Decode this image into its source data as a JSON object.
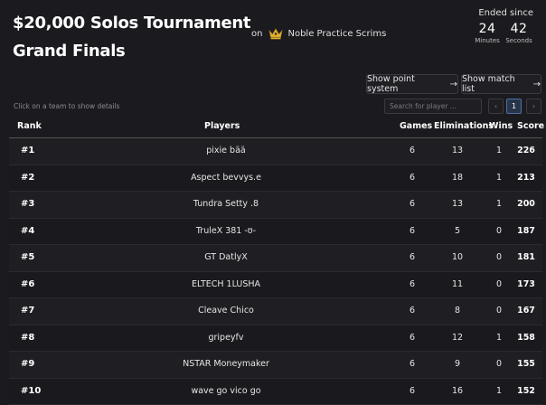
{
  "tournament": {
    "title_line1": "$20,000 Solos Tournament",
    "title_line2": "Grand Finals",
    "on_label": "on",
    "organizer": "Noble Practice Scrims",
    "organizer_icon": "crown-icon",
    "accent_color": "#e0b030"
  },
  "countdown": {
    "label": "Ended since",
    "minutes": "24",
    "minutes_label": "Minutes",
    "seconds": "42",
    "seconds_label": "Seconds"
  },
  "actions": {
    "point_system": "Show point system",
    "match_list": "Show match list",
    "arrow": "→"
  },
  "controls": {
    "hint": "Click on a team to show details",
    "search_placeholder": "Search for player ...",
    "prev": "‹",
    "current_page": "1",
    "next": "›"
  },
  "table": {
    "headers": {
      "rank": "Rank",
      "players": "Players",
      "games": "Games",
      "eliminations": "Eliminations",
      "wins": "Wins",
      "score": "Score"
    },
    "rows": [
      {
        "rank": "#1",
        "player": "pixie bää",
        "games": "6",
        "eliminations": "13",
        "wins": "1",
        "score": "226"
      },
      {
        "rank": "#2",
        "player": "Aspect bevvys.e",
        "games": "6",
        "eliminations": "18",
        "wins": "1",
        "score": "213"
      },
      {
        "rank": "#3",
        "player": "Tundra Setty .8",
        "games": "6",
        "eliminations": "13",
        "wins": "1",
        "score": "200"
      },
      {
        "rank": "#4",
        "player": "TruleX 381 -ʊ-",
        "games": "6",
        "eliminations": "5",
        "wins": "0",
        "score": "187"
      },
      {
        "rank": "#5",
        "player": "GT DatlyX",
        "games": "6",
        "eliminations": "10",
        "wins": "0",
        "score": "181"
      },
      {
        "rank": "#6",
        "player": "ELTECH 1LUSHA",
        "games": "6",
        "eliminations": "11",
        "wins": "0",
        "score": "173"
      },
      {
        "rank": "#7",
        "player": "Cleave Chico",
        "games": "6",
        "eliminations": "8",
        "wins": "0",
        "score": "167"
      },
      {
        "rank": "#8",
        "player": "gripeyfv",
        "games": "6",
        "eliminations": "12",
        "wins": "1",
        "score": "158"
      },
      {
        "rank": "#9",
        "player": "NSTAR Moneymaker",
        "games": "6",
        "eliminations": "9",
        "wins": "0",
        "score": "155"
      },
      {
        "rank": "#10",
        "player": "wave go vico go",
        "games": "6",
        "eliminations": "16",
        "wins": "1",
        "score": "152"
      }
    ]
  }
}
